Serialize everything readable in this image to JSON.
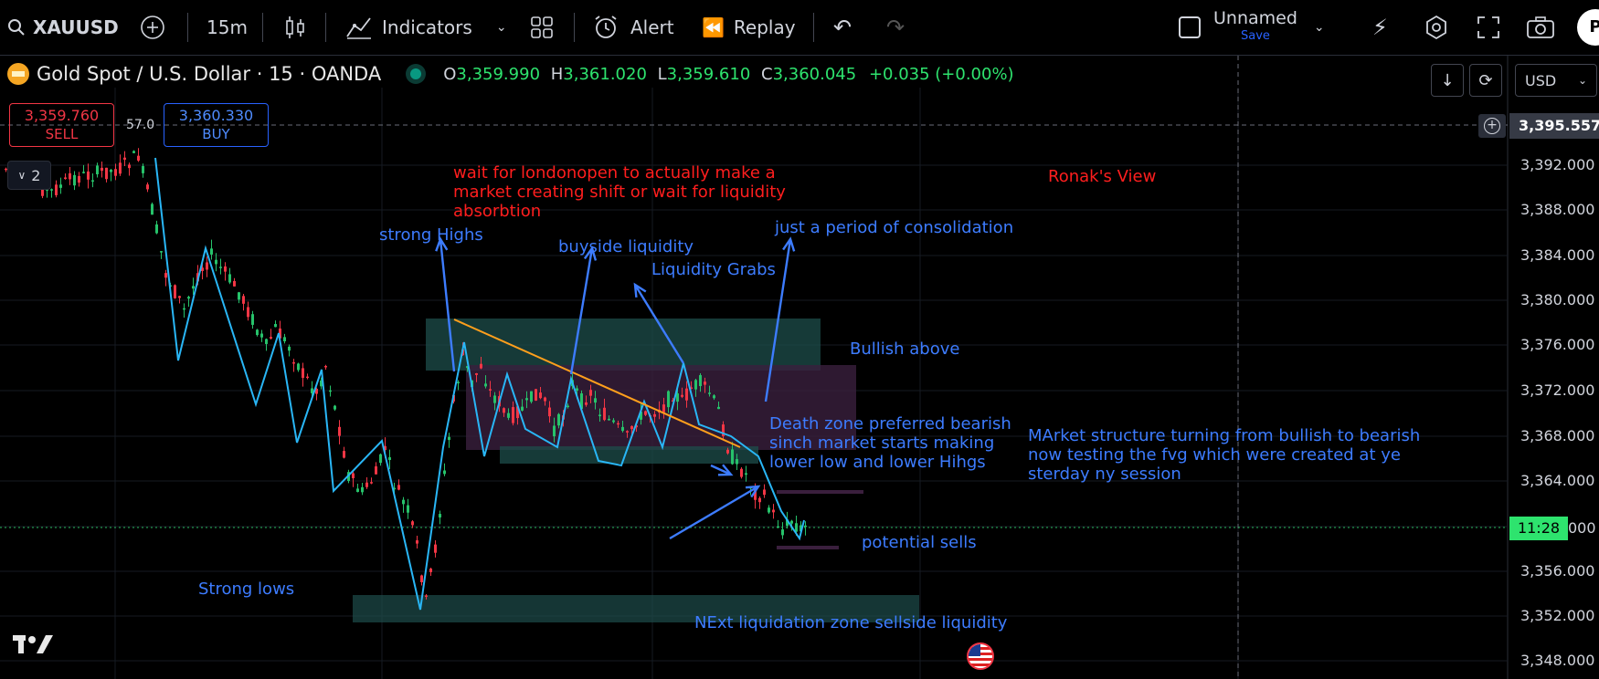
{
  "toolbar": {
    "symbol": "XAUUSD",
    "interval": "15m",
    "indicators_label": "Indicators",
    "alert_label": "Alert",
    "replay_label": "Replay",
    "layout_name": "Unnamed",
    "save_label": "Save",
    "profile_initial": "P"
  },
  "symbol_bar": {
    "title": "Gold Spot / U.S. Dollar · 15 · OANDA",
    "o_label": "O",
    "o_value": "3,359.990",
    "h_label": "H",
    "h_value": "3,361.020",
    "l_label": "L",
    "l_value": "3,359.610",
    "c_label": "C",
    "c_value": "3,360.045",
    "change": "+0.035 (+0.00%)"
  },
  "trade": {
    "sell_price": "3,359.760",
    "sell_label": "SELL",
    "spread": "57.0",
    "buy_price": "3,360.330",
    "buy_label": "BUY"
  },
  "indicator_toggle": "2",
  "currency": "USD",
  "price_scale": {
    "crosshair_price": "3,395.557",
    "countdown": "11:28",
    "last_price_suffix": "000",
    "ticks": [
      "3,392.000",
      "3,388.000",
      "3,384.000",
      "3,380.000",
      "3,376.000",
      "3,372.000",
      "3,368.000",
      "3,364.000",
      "3,356.000",
      "3,352.000",
      "3,348.000"
    ]
  },
  "annotations": {
    "london": "wait for londonopen to actually make a\nmarket creating shift or wait for liquidity\nabsorbtion",
    "ronak": "Ronak's View",
    "strong_highs": "strong Highs",
    "buyside": "buyside liquidity",
    "grabs": "Liquidity Grabs",
    "consolidation": "just a period of consolidation",
    "bullish": "Bullish above",
    "death_zone": "Death zone preferred bearish\nsinch market starts making\nlower low and lower Hihgs",
    "structure": "MArket structure turning from bullish to bearish\nnow testing the fvg which were created at ye\nsterday ny session",
    "potential": "potential sells",
    "strong_lows": "Strong lows",
    "next_zone": "NExt liquidation zone sellside liquidity"
  },
  "colors": {
    "up": "#26c26a",
    "down": "#f23645",
    "zigzag": "#29b6f6",
    "trend": "#ff9f1c",
    "annotation_blue": "#3d7cff",
    "annotation_red": "#ff1e1e",
    "zone_teal": "#1e4d4b",
    "zone_purple": "#3a1f3d",
    "last_price": "#2ee36e"
  }
}
